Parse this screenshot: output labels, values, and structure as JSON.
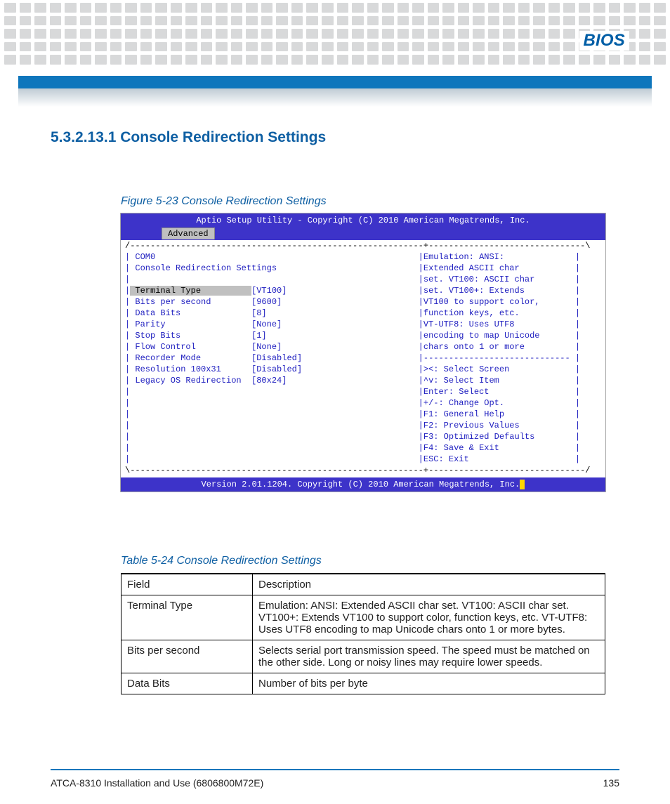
{
  "header": {
    "title": "BIOS"
  },
  "section": {
    "heading": "5.3.2.13.1 Console Redirection Settings"
  },
  "figure": {
    "caption": "Figure 5-23     Console Redirection Settings"
  },
  "bios": {
    "titlebar": "Aptio Setup Utility - Copyright (C) 2010 American Megatrends, Inc.",
    "tab": "Advanced",
    "com_label": "COM0",
    "subheading": "Console Redirection Settings",
    "rows": [
      {
        "label": "Terminal Type",
        "value": "[VT100]"
      },
      {
        "label": "Bits per second",
        "value": "[9600]"
      },
      {
        "label": "Data Bits",
        "value": "[8]"
      },
      {
        "label": "Parity",
        "value": "[None]"
      },
      {
        "label": "Stop Bits",
        "value": "[1]"
      },
      {
        "label": "Flow Control",
        "value": "[None]"
      },
      {
        "label": "Recorder Mode",
        "value": "[Disabled]"
      },
      {
        "label": "Resolution 100x31",
        "value": "[Disabled]"
      },
      {
        "label": "Legacy OS Redirection",
        "value": "[80x24]"
      }
    ],
    "help": [
      "Emulation: ANSI:",
      "Extended ASCII char",
      "set. VT100: ASCII char",
      "set. VT100+: Extends",
      "VT100 to support color,",
      "function keys, etc.",
      "VT-UTF8: Uses UTF8",
      "encoding to map Unicode",
      "chars onto 1 or more"
    ],
    "keys": [
      "><: Select Screen",
      "^v: Select Item",
      "Enter: Select",
      "+/-: Change Opt.",
      "F1: General Help",
      "F2: Previous Values",
      "F3: Optimized Defaults",
      "F4: Save & Exit",
      "ESC: Exit"
    ],
    "bottombar": "Version 2.01.1204. Copyright (C) 2010 American Megatrends, Inc."
  },
  "tablecap": {
    "caption": "Table 5-24 Console Redirection Settings"
  },
  "table": {
    "h1": "Field",
    "h2": "Description",
    "rows": [
      {
        "field": "Terminal Type",
        "desc": "Emulation: ANSI: Extended ASCII char set. VT100: ASCII char set. VT100+: Extends VT100 to support color, function keys, etc. VT-UTF8: Uses UTF8 encoding to map Unicode chars onto 1 or more bytes."
      },
      {
        "field": "Bits per second",
        "desc": "Selects serial port transmission speed. The speed must be matched on the other side. Long or noisy lines may require lower speeds."
      },
      {
        "field": "Data Bits",
        "desc": "Number of bits per byte"
      }
    ]
  },
  "footer": {
    "left": "ATCA-8310 Installation and Use (6806800M72E)",
    "page": "135"
  }
}
